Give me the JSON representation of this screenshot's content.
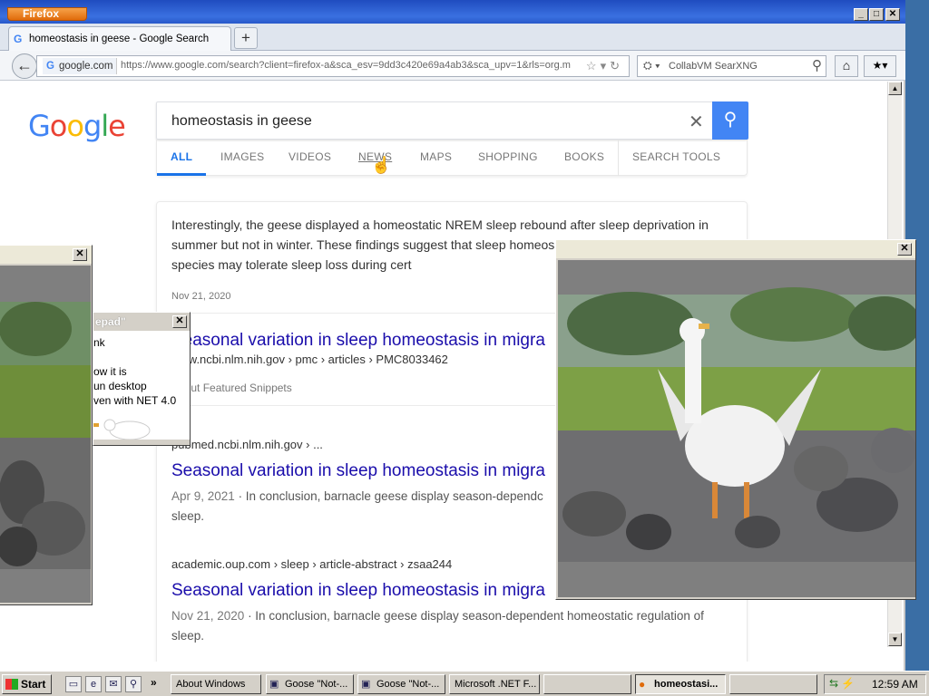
{
  "browser": {
    "app_button": "Firefox",
    "tab": {
      "title": "homeostasis in geese - Google Search",
      "icon": "google-favicon"
    },
    "new_tab": "+",
    "url_site": "google.com",
    "url": "https://www.google.com/search?client=firefox-a&sca_esv=9dd3c420e69a4ab3&sca_upv=1&rls=org.m",
    "search_engine": "CollabVM SearXNG",
    "window_controls": {
      "minimize": "_",
      "maximize": "□",
      "close": "✕"
    }
  },
  "google": {
    "logo": [
      "G",
      "o",
      "o",
      "g",
      "l",
      "e"
    ],
    "query": "homeostasis in geese",
    "tabs": [
      "ALL",
      "IMAGES",
      "VIDEOS",
      "NEWS",
      "MAPS",
      "SHOPPING",
      "BOOKS",
      "SEARCH TOOLS"
    ],
    "active_tab": "ALL",
    "featured": {
      "snippet": "Interestingly, the geese displayed a homeostatic NREM sleep rebound after sleep deprivation in summer but not in winter. These findings suggest that sleep homeos phenomenon and some species may tolerate sleep loss during cert",
      "date": "Nov 21, 2020",
      "title": "Seasonal variation in sleep homeostasis in migra",
      "url": "www.ncbi.nlm.nih.gov › pmc › articles › PMC8033462",
      "about": "About Featured Snippets"
    },
    "results": [
      {
        "url": "pubmed.ncbi.nlm.nih.gov › ...",
        "title": "Seasonal variation in sleep homeostasis in migra",
        "date": "Apr 9, 2021",
        "desc": " · In conclusion, barnacle geese display season-dependc",
        "desc2": "sleep."
      },
      {
        "url": "academic.oup.com › sleep › article-abstract › zsaa244",
        "title": "Seasonal variation in sleep homeostasis in migra",
        "date": "Nov 21, 2020",
        "desc": " · In conclusion, barnacle geese display season-dependent homeostatic regulation of",
        "desc2": "sleep."
      }
    ]
  },
  "notepad": {
    "title": "epad\"",
    "lines": [
      "nk",
      "",
      "ow it is",
      "un desktop",
      "ven with NET 4.0"
    ]
  },
  "taskbar": {
    "start": "Start",
    "buttons": [
      {
        "label": "About Windows",
        "active": false
      },
      {
        "label": "Goose \"Not-...",
        "active": false
      },
      {
        "label": "Goose \"Not-...",
        "active": false
      },
      {
        "label": "Microsoft .NET F...",
        "active": false
      },
      {
        "label": "",
        "active": false
      },
      {
        "label": "homeostasi...",
        "active": true
      },
      {
        "label": "",
        "active": false
      }
    ],
    "clock": "12:59 AM"
  },
  "colors": {
    "google_blue": "#4285f4",
    "link_blue": "#1a0dab",
    "titlebar": "#1f4cbf",
    "firefox_orange": "#e06b0b"
  }
}
